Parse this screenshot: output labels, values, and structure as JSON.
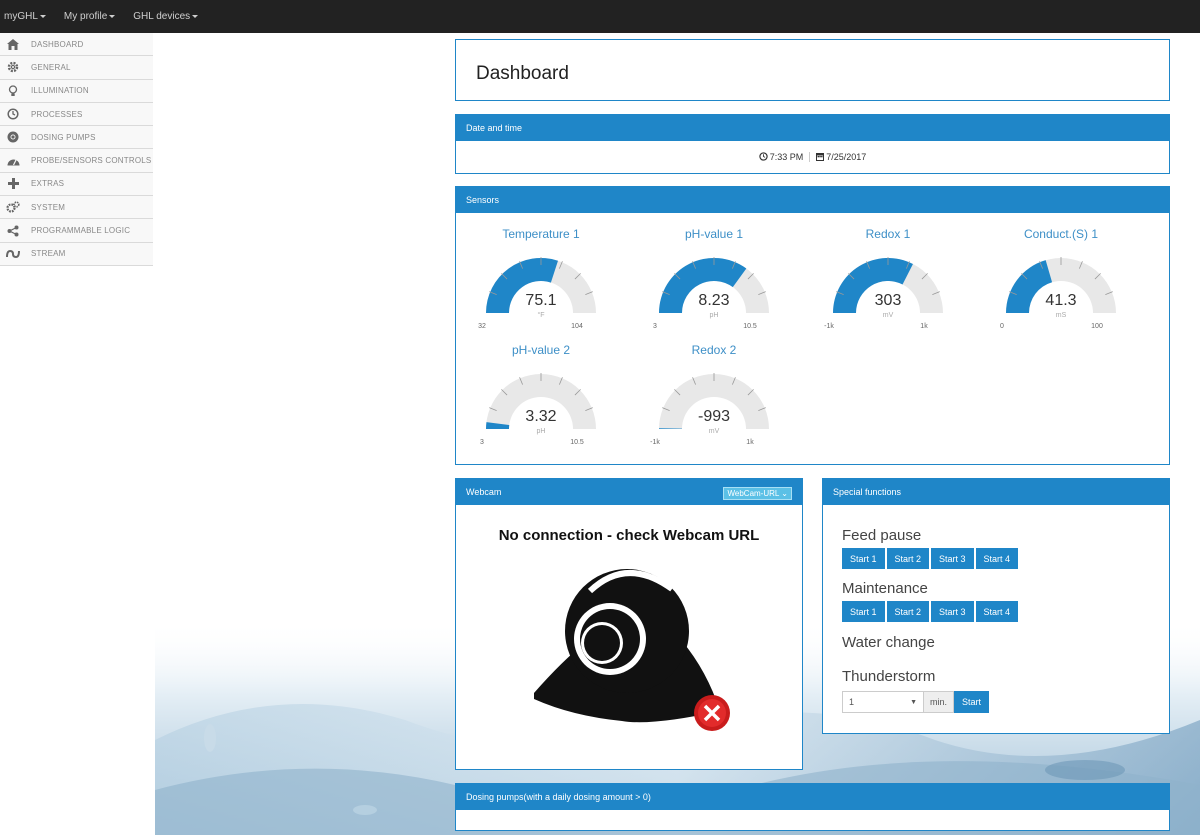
{
  "topbar": {
    "items": [
      {
        "label": "myGHL"
      },
      {
        "label": "My profile"
      },
      {
        "label": "GHL devices"
      }
    ]
  },
  "sidebar": {
    "items": [
      {
        "label": "DASHBOARD",
        "icon": "home-icon"
      },
      {
        "label": "GENERAL",
        "icon": "gear-icon"
      },
      {
        "label": "ILLUMINATION",
        "icon": "lightbulb-icon"
      },
      {
        "label": "PROCESSES",
        "icon": "clock-icon"
      },
      {
        "label": "DOSING PUMPS",
        "icon": "chrome-icon"
      },
      {
        "label": "PROBE/SENSORS CONTROLS",
        "icon": "dashboard-icon"
      },
      {
        "label": "EXTRAS",
        "icon": "plus-icon"
      },
      {
        "label": "SYSTEM",
        "icon": "gears-icon"
      },
      {
        "label": "PROGRAMMABLE LOGIC",
        "icon": "share-icon"
      },
      {
        "label": "STREAM",
        "icon": "stream-icon"
      }
    ]
  },
  "page": {
    "title": "Dashboard"
  },
  "datetime": {
    "header": "Date and time",
    "time": "7:33 PM",
    "date": "7/25/2017"
  },
  "sensors": {
    "header": "Sensors",
    "gauges": [
      {
        "title": "Temperature 1",
        "value": "75.1",
        "unit": "°F",
        "min": "32",
        "max": "104",
        "fraction": 0.6
      },
      {
        "title": "pH-value 1",
        "value": "8.23",
        "unit": "pH",
        "min": "3",
        "max": "10.5",
        "fraction": 0.7
      },
      {
        "title": "Redox 1",
        "value": "303",
        "unit": "mV",
        "min": "-1k",
        "max": "1k",
        "fraction": 0.65
      },
      {
        "title": "Conduct.(S) 1",
        "value": "41.3",
        "unit": "mS",
        "min": "0",
        "max": "100",
        "fraction": 0.41
      },
      {
        "title": "pH-value 2",
        "value": "3.32",
        "unit": "pH",
        "min": "3",
        "max": "10.5",
        "fraction": 0.04
      },
      {
        "title": "Redox 2",
        "value": "-993",
        "unit": "mV",
        "min": "-1k",
        "max": "1k",
        "fraction": 0.004
      }
    ],
    "colors": {
      "fill": "#1f86c8",
      "track": "#e8e8e8"
    }
  },
  "webcam": {
    "header": "Webcam",
    "select_label": "WebCam-URL",
    "message": "No connection - check Webcam URL"
  },
  "special": {
    "header": "Special functions",
    "feed_pause": "Feed pause",
    "feed_buttons": [
      "Start 1",
      "Start 2",
      "Start 3",
      "Start 4"
    ],
    "maintenance": "Maintenance",
    "maint_buttons": [
      "Start 1",
      "Start 2",
      "Start 3",
      "Start 4"
    ],
    "water_change": "Water change",
    "thunderstorm": "Thunderstorm",
    "storm_value": "1",
    "storm_unit": "min.",
    "storm_button": "Start"
  },
  "dosing": {
    "header": "Dosing pumps(with a daily dosing amount > 0)"
  }
}
